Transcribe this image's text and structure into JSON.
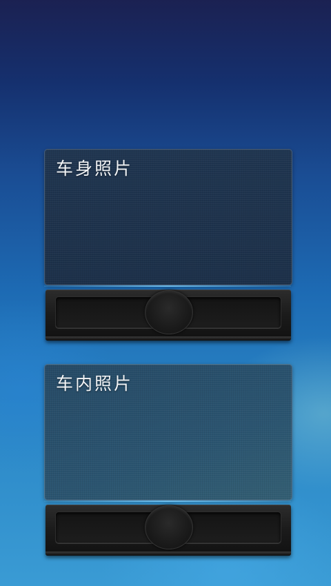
{
  "cards": [
    {
      "label": "车身照片"
    },
    {
      "label": "车内照片"
    }
  ],
  "colors": {
    "background_top": "#1b2152",
    "background_bottom": "#3a9bd4",
    "accent_line": "#78c8f5",
    "tray": "#1b1b1b"
  }
}
